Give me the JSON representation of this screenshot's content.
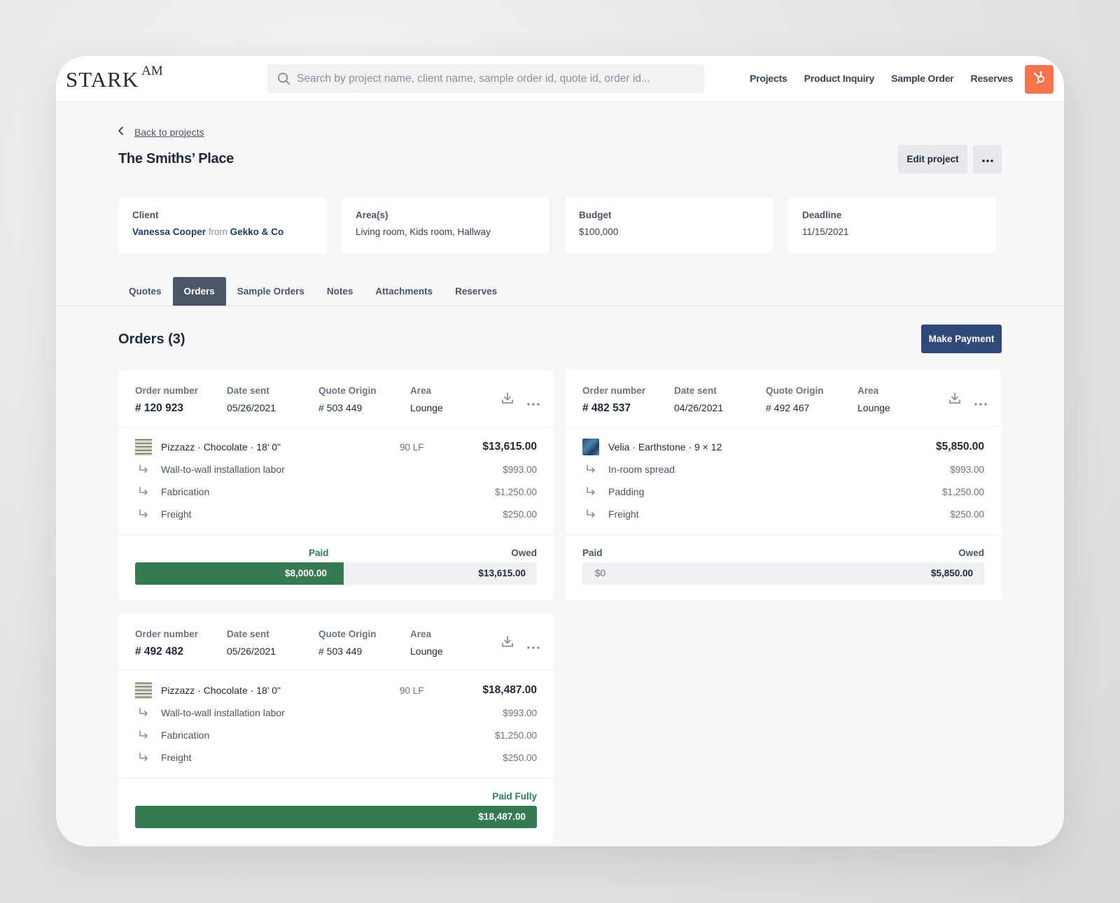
{
  "brand": {
    "name": "STARK",
    "suffix": "AM"
  },
  "search": {
    "placeholder": "Search by project name, client name, sample order id, quote id, order id..."
  },
  "nav": [
    "Projects",
    "Product Inquiry",
    "Sample Order",
    "Reserves"
  ],
  "page": {
    "back_label": "Back to projects",
    "title": "The Smiths’ Place",
    "edit_label": "Edit project"
  },
  "info": {
    "client_label": "Client",
    "client_name": "Vanessa Cooper",
    "client_from": "from",
    "client_company": "Gekko & Co",
    "areas_label": "Area(s)",
    "areas_value": "Living room, Kids room, Hallway",
    "budget_label": "Budget",
    "budget_value": "$100,000",
    "deadline_label": "Deadline",
    "deadline_value": "11/15/2021"
  },
  "tabs": [
    "Quotes",
    "Orders",
    "Sample Orders",
    "Notes",
    "Attachments",
    "Reserves"
  ],
  "active_tab": "Orders",
  "orders_title": "Orders (3)",
  "pay_button": "Make Payment",
  "meta_labels": {
    "order": "Order number",
    "date": "Date sent",
    "quote": "Quote Origin",
    "area": "Area"
  },
  "orders": [
    {
      "number": "# 120 923",
      "date": "05/26/2021",
      "quote": "# 503 449",
      "area": "Lounge",
      "product": {
        "name": "Pizzazz",
        "color": "Chocolate",
        "size": "18’ 0\"",
        "qty": "90 LF",
        "price": "$13,615.00",
        "swatch": "weave"
      },
      "subs": [
        {
          "name": "Wall-to-wall installation labor",
          "price": "$993.00"
        },
        {
          "name": "Fabrication",
          "price": "$1,250.00"
        },
        {
          "name": "Freight",
          "price": "$250.00"
        }
      ],
      "paid_label": "Paid",
      "owed_label": "Owed",
      "paid_amount": "$8,000.00",
      "owed_amount": "$13,615.00",
      "paid_fraction": 0.52
    },
    {
      "number": "# 482 537",
      "date": "04/26/2021",
      "quote": "# 492 467",
      "area": "Lounge",
      "product": {
        "name": "Velia",
        "color": "Earthstone",
        "size": "9 × 12",
        "qty": "",
        "price": "$5,850.00",
        "swatch": "blue"
      },
      "subs": [
        {
          "name": "In-room spread",
          "price": "$993.00"
        },
        {
          "name": "Padding",
          "price": "$1,250.00"
        },
        {
          "name": "Freight",
          "price": "$250.00"
        }
      ],
      "paid_label": "Paid",
      "owed_label": "Owed",
      "paid_amount": "$0",
      "owed_amount": "$5,850.00",
      "paid_fraction": 0
    },
    {
      "number": "# 492 482",
      "date": "05/26/2021",
      "quote": "# 503 449",
      "area": "Lounge",
      "product": {
        "name": "Pizzazz",
        "color": "Chocolate",
        "size": "18’ 0\"",
        "qty": "90 LF",
        "price": "$18,487.00",
        "swatch": "weave"
      },
      "subs": [
        {
          "name": "Wall-to-wall installation labor",
          "price": "$993.00"
        },
        {
          "name": "Fabrication",
          "price": "$1,250.00"
        },
        {
          "name": "Freight",
          "price": "$250.00"
        }
      ],
      "paid_label": "Paid Fully",
      "owed_label": "",
      "paid_amount": "$18,487.00",
      "owed_amount": "",
      "paid_fraction": 1
    }
  ],
  "colors": {
    "accent": "#2f4a7a",
    "paid": "#367a53",
    "hubspot": "#f7744d",
    "active_tab": "#4c5766"
  }
}
